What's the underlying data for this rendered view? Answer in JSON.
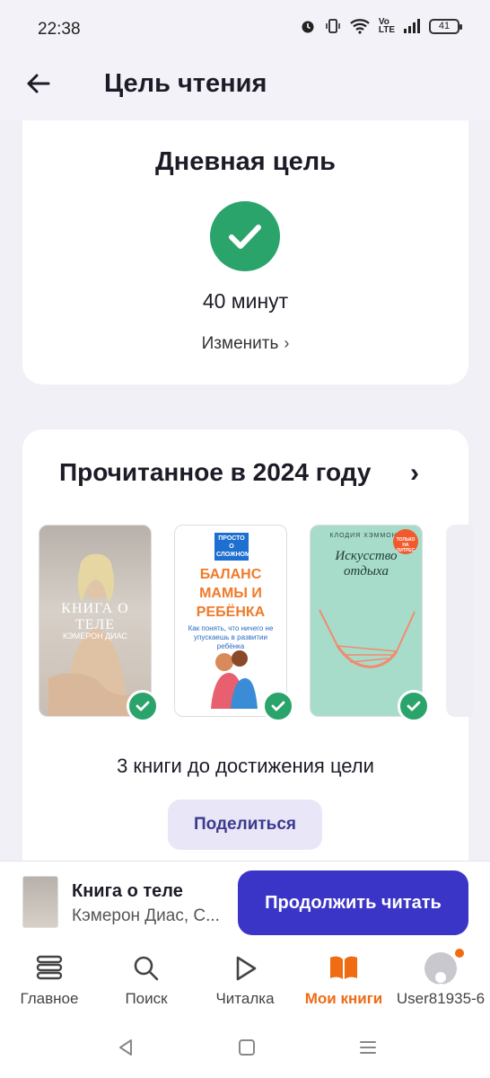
{
  "status_bar": {
    "time": "22:38",
    "battery": "41"
  },
  "header": {
    "title": "Цель чтения"
  },
  "daily_goal": {
    "title": "Дневная цель",
    "value": "40 минут",
    "change_label": "Изменить"
  },
  "read_section": {
    "title": "Прочитанное в 2024 году",
    "books": [
      {
        "title": "КНИГА О ТЕЛЕ",
        "author": "КЭМЕРОН ДИАС"
      },
      {
        "series": "ПРОСТО О СЛОЖНОМ",
        "title": "БАЛАНС МАМЫ И РЕБЁНКА",
        "subtitle": "Как понять, что ничего не упускаешь в развитии ребёнка"
      },
      {
        "author": "КЛОДИЯ ХЭММОНД",
        "title": "Искусство отдыха",
        "badge": "ТОЛЬКО НА ЛИТРЕС"
      }
    ],
    "remaining": "3 книги до достижения цели",
    "share_label": "Поделиться"
  },
  "mini_player": {
    "title": "Книга о теле",
    "author": "Кэмерон Диас, С...",
    "continue_label": "Продолжить читать"
  },
  "bottom_nav": {
    "items": [
      {
        "label": "Главное"
      },
      {
        "label": "Поиск"
      },
      {
        "label": "Читалка"
      },
      {
        "label": "Мои книги"
      },
      {
        "label": "User81935-6"
      }
    ],
    "active_color": "#ef6b14"
  },
  "colors": {
    "accent": "#3a35c7",
    "success": "#2aa46a"
  }
}
